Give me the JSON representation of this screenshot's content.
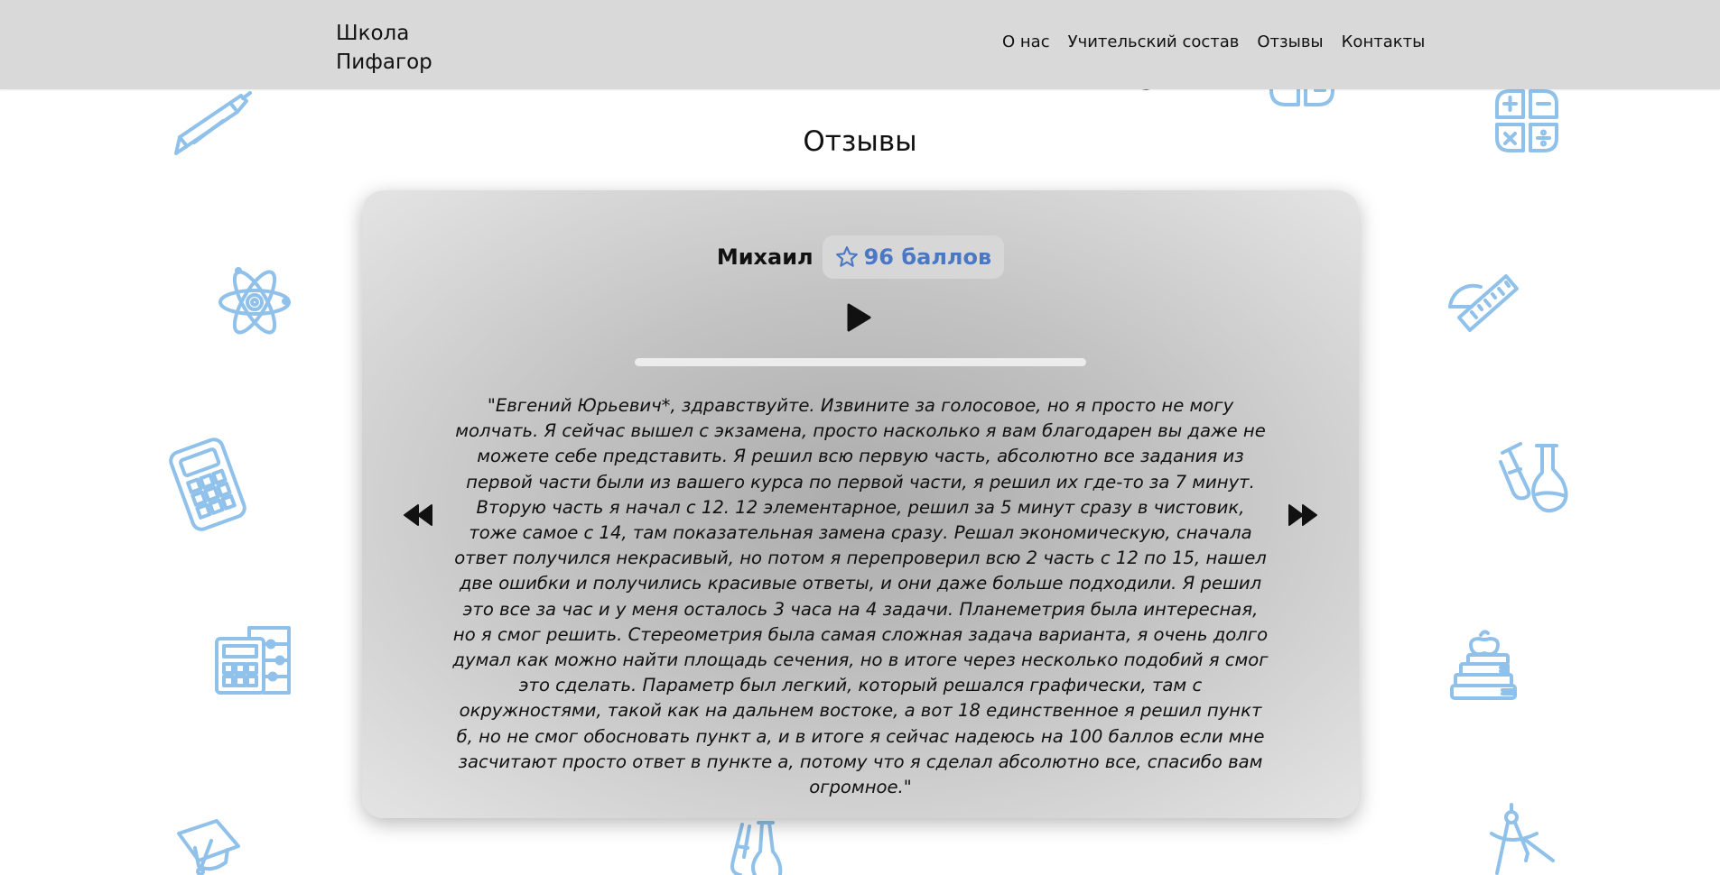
{
  "header": {
    "logo_line1": "Школа",
    "logo_line2": "Пифагор",
    "nav": [
      "О нас",
      "Учительский состав",
      "Отзывы",
      "Контакты"
    ]
  },
  "section": {
    "title": "Отзывы"
  },
  "review": {
    "name": "Михаил",
    "score": "96 баллов",
    "audio_progress": 0,
    "text": "\"Евгений Юрьевич*, здравствуйте. Извините за голосовое, но я просто не могу молчать. Я сейчас вышел с экзамена, просто насколько я вам благодарен вы даже не можете себе представить. Я решил всю первую часть, абсолютно все задания из первой части были из вашего курса по первой части, я решил их где-то за 7 минут. Вторую часть я начал с 12. 12 элементарное, решил за 5 минут сразу в чистовик, тоже самое с 14, там показательная замена сразу. Решал экономическую, сначала ответ получился некрасивый, но потом я перепроверил всю 2 часть с 12 по 15, нашел две ошибки и получились красивые ответы, и они даже больше подходили. Я решил это все за час и у меня осталось 3 часа на 4 задачи. Планеметрия была интересная, но я смог решить. Стереометрия была самая сложная задача варианта, я очень долго думал как можно найти площадь сечения, но в итоге через несколько подобий я смог это сделать. Параметр был легкий, который решался графически, там с окружностями, такой как на дальнем востоке, а вот 18 единственное я решил пункт б, но не смог обосновать пункт а, и в итоге я сейчас надеюсь на 100 баллов если мне засчитают просто ответ в пункте а, потому что я сделал абсолютно все, спасибо вам огромное.\""
  },
  "colors": {
    "header_bg": "#d9d9d9",
    "icon_blue": "#8fc1ea",
    "score_blue": "#4a78c4"
  },
  "icons": [
    "pen-icon",
    "calculator-operations-icon",
    "atom-icon",
    "ruler-protractor-icon",
    "calculator-icon",
    "flasks-icon",
    "abacus-calculator-icon",
    "books-apple-icon",
    "graduation-cap-icon",
    "test-tubes-icon",
    "compass-icon",
    "star-icon",
    "play-icon",
    "rewind-icon",
    "fast-forward-icon"
  ]
}
